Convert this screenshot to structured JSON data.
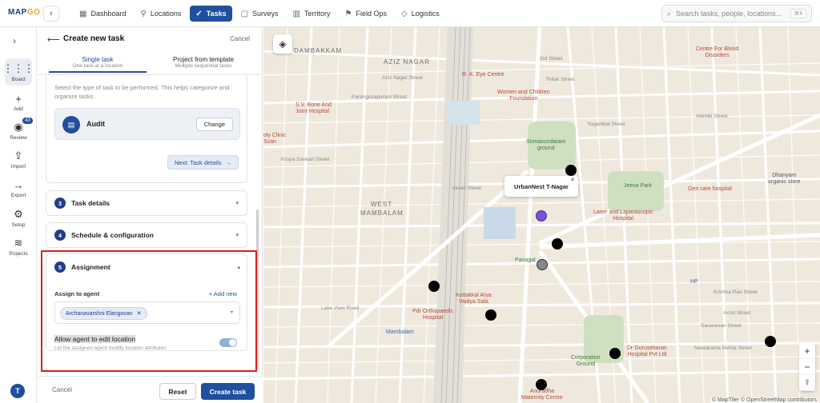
{
  "app": {
    "logo_text": "MAP",
    "logo_accent": "GO",
    "brand_color": "#1f4f9e"
  },
  "nav": {
    "tabs": [
      {
        "label": "Dashboard",
        "icon": "bar-chart-icon"
      },
      {
        "label": "Locations",
        "icon": "pin-icon"
      },
      {
        "label": "Tasks",
        "icon": "check-icon",
        "active": true
      },
      {
        "label": "Surveys",
        "icon": "document-icon"
      },
      {
        "label": "Territory",
        "icon": "map-icon"
      },
      {
        "label": "Field Ops",
        "icon": "flag-icon"
      },
      {
        "label": "Logistics",
        "icon": "box-icon"
      }
    ],
    "search_placeholder": "Search tasks, people, locations...",
    "search_shortcut": "⌘K"
  },
  "rail": {
    "items": [
      {
        "label": "Board",
        "active": true
      },
      {
        "label": "Add"
      },
      {
        "label": "Review",
        "badge": "43"
      },
      {
        "label": "Import"
      },
      {
        "label": "Export"
      },
      {
        "label": "Setup"
      },
      {
        "label": "Projects"
      }
    ],
    "avatar": "T"
  },
  "panel": {
    "title": "Create new task",
    "cancel": "Cancel",
    "tabs": [
      {
        "label": "Single task",
        "sub": "One task at a location",
        "active": true
      },
      {
        "label": "Project from template",
        "sub": "Multiple sequential tasks"
      }
    ],
    "type_desc": "Select the type of task to be performed. This helps categorize and organize tasks.",
    "task_type": "Audit",
    "change": "Change",
    "next": "Next: Task details",
    "sections": [
      {
        "num": "3",
        "title": "Task details"
      },
      {
        "num": "4",
        "title": "Schedule & configuration"
      },
      {
        "num": "5",
        "title": "Assignment"
      }
    ],
    "assign_label": "Assign to agent",
    "add_new": "+ Add new",
    "agent": "Archanavarshni Elangovan",
    "allow_title": "Allow agent to edit location",
    "allow_sub": "Let the assigned agent modify location attributes",
    "allow_enabled": true,
    "footer_cancel": "Cancel",
    "reset": "Reset",
    "create": "Create task"
  },
  "map": {
    "popup": "UrbanNest T-Nagar",
    "attribution": "© MapTiler © OpenStreetMap contributors",
    "labels": {
      "dambakkam": "DAMBAKKAM",
      "aziz": "AZIZ NAGAR",
      "west": "WEST",
      "mambalam": "MAMBALAM",
      "rk": "R. K. Eye Centre",
      "women": "Women and Children\nFoundation",
      "sv": "S.V. Bone And\nJoint Hospital",
      "centre": "Centre For Blood\nDisorders",
      "soma": "Somasundaram\nground",
      "jeeva": "Jeeva Park",
      "laser": "Laser and Laparascopic\nHospital",
      "geri": "Geri care hospital",
      "dhanyam": "Dhanyam\norganic store",
      "panagal": "Panagal",
      "kottakkal": "Kottakkal Arya\nVaidya Sala",
      "pdr": "Pdr Orthopaedic\nHospital",
      "mambalam_station": "Mambalam",
      "corp": "Corporation\nGround",
      "guru": "Dr Gurusekaran\nHospital Pvt Ltd",
      "anuradha": "Anuradha\nMaternity Centre",
      "clinic": "oly Clinic\nScan",
      "hp": "HP",
      "street_3rd": "3rd Street",
      "thilak": "Thilak Street",
      "ramanan": "Ramanan Street",
      "yogambal": "Yogambal Street",
      "valmiki": "Valmiki Street",
      "vasan": "Vasan Street",
      "krupa": "Krupa Sankari Street",
      "cross": "Cross Street",
      "parangu": "Parangusapuram Street",
      "aziz_st": "Aziz Nagar Street",
      "krishna": "Krishna Rao Street",
      "arcot": "Arcot Street",
      "saravanan": "Saravanan Street",
      "neelakanta": "Neelakanta Mehta Street",
      "doctor": "Doctor Nair Road",
      "lake": "Lake View Road",
      "dhandapani": "Dhandapani Street",
      "anderson": "Anderson Street",
      "rajan": "Rajan Street",
      "care_hospital": "Care Hospital",
      "hospital_top": "Hospital Lane"
    }
  }
}
